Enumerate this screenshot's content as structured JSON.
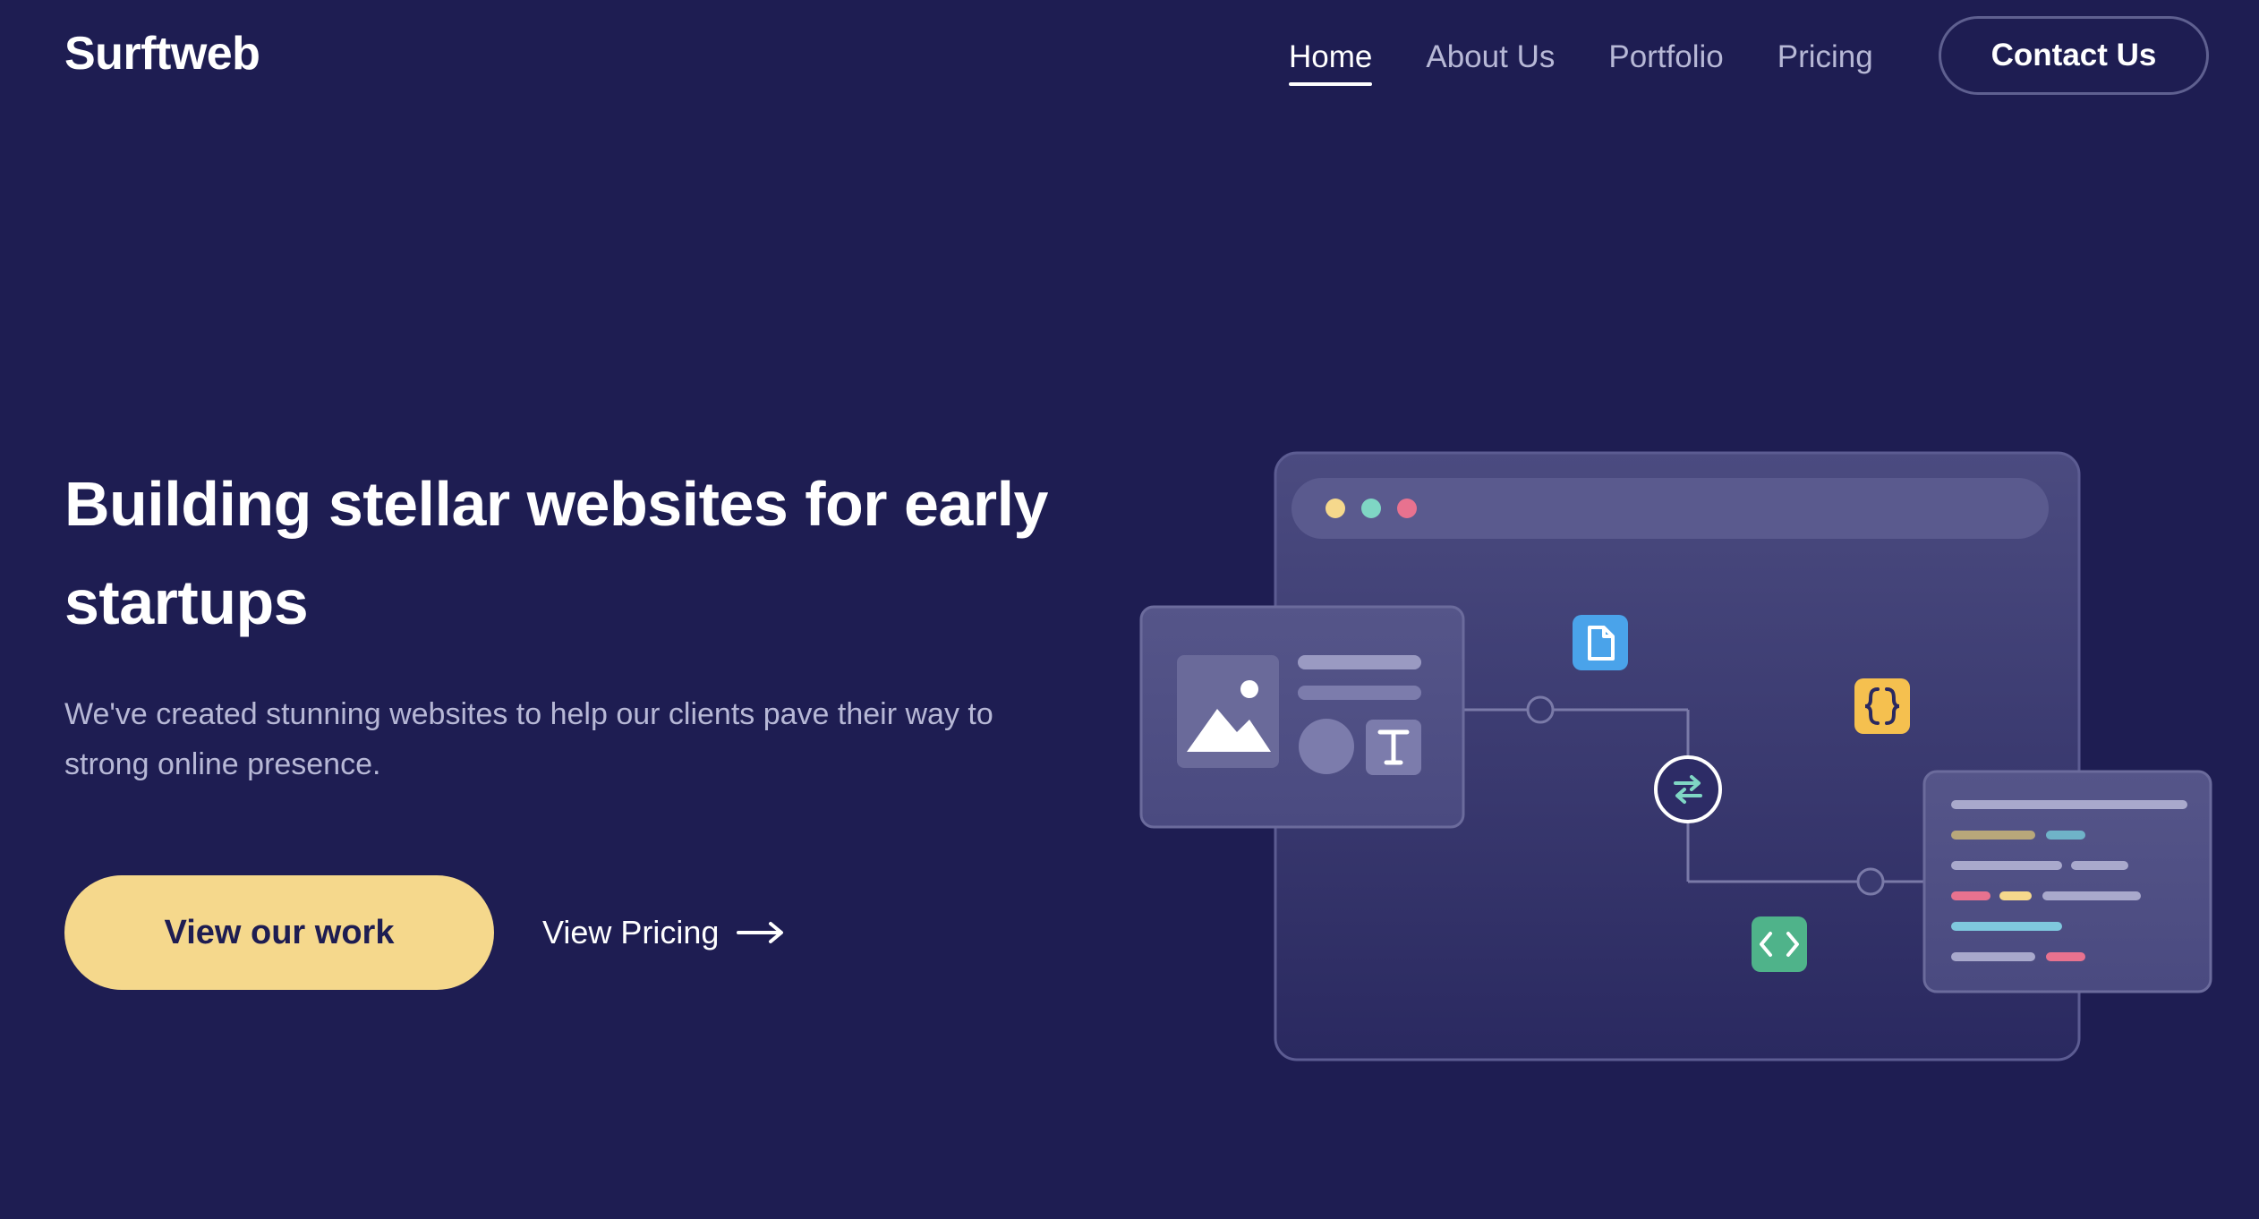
{
  "header": {
    "logo": "Surftweb",
    "nav": [
      {
        "label": "Home",
        "active": true
      },
      {
        "label": "About Us",
        "active": false
      },
      {
        "label": "Portfolio",
        "active": false
      },
      {
        "label": "Pricing",
        "active": false
      }
    ],
    "contact_label": "Contact Us"
  },
  "hero": {
    "title": "Building stellar websites for early startups",
    "description": "We've created stunning websites to help our clients pave their way to strong online presence.",
    "primary_button": "View our work",
    "secondary_link": "View Pricing"
  },
  "illustration": {
    "window_dots": [
      "#f5d88c",
      "#7fd6c4",
      "#e8728f"
    ],
    "icons": [
      "image-icon",
      "text-icon",
      "file-icon",
      "code-braces-icon",
      "sync-icon",
      "code-tag-icon"
    ],
    "colors": {
      "file_badge": "#4aa3ea",
      "braces_badge": "#f5c04f",
      "code_badge": "#4fb38a",
      "accent_yellow": "#f5d88c",
      "background": "#1e1d52"
    }
  }
}
